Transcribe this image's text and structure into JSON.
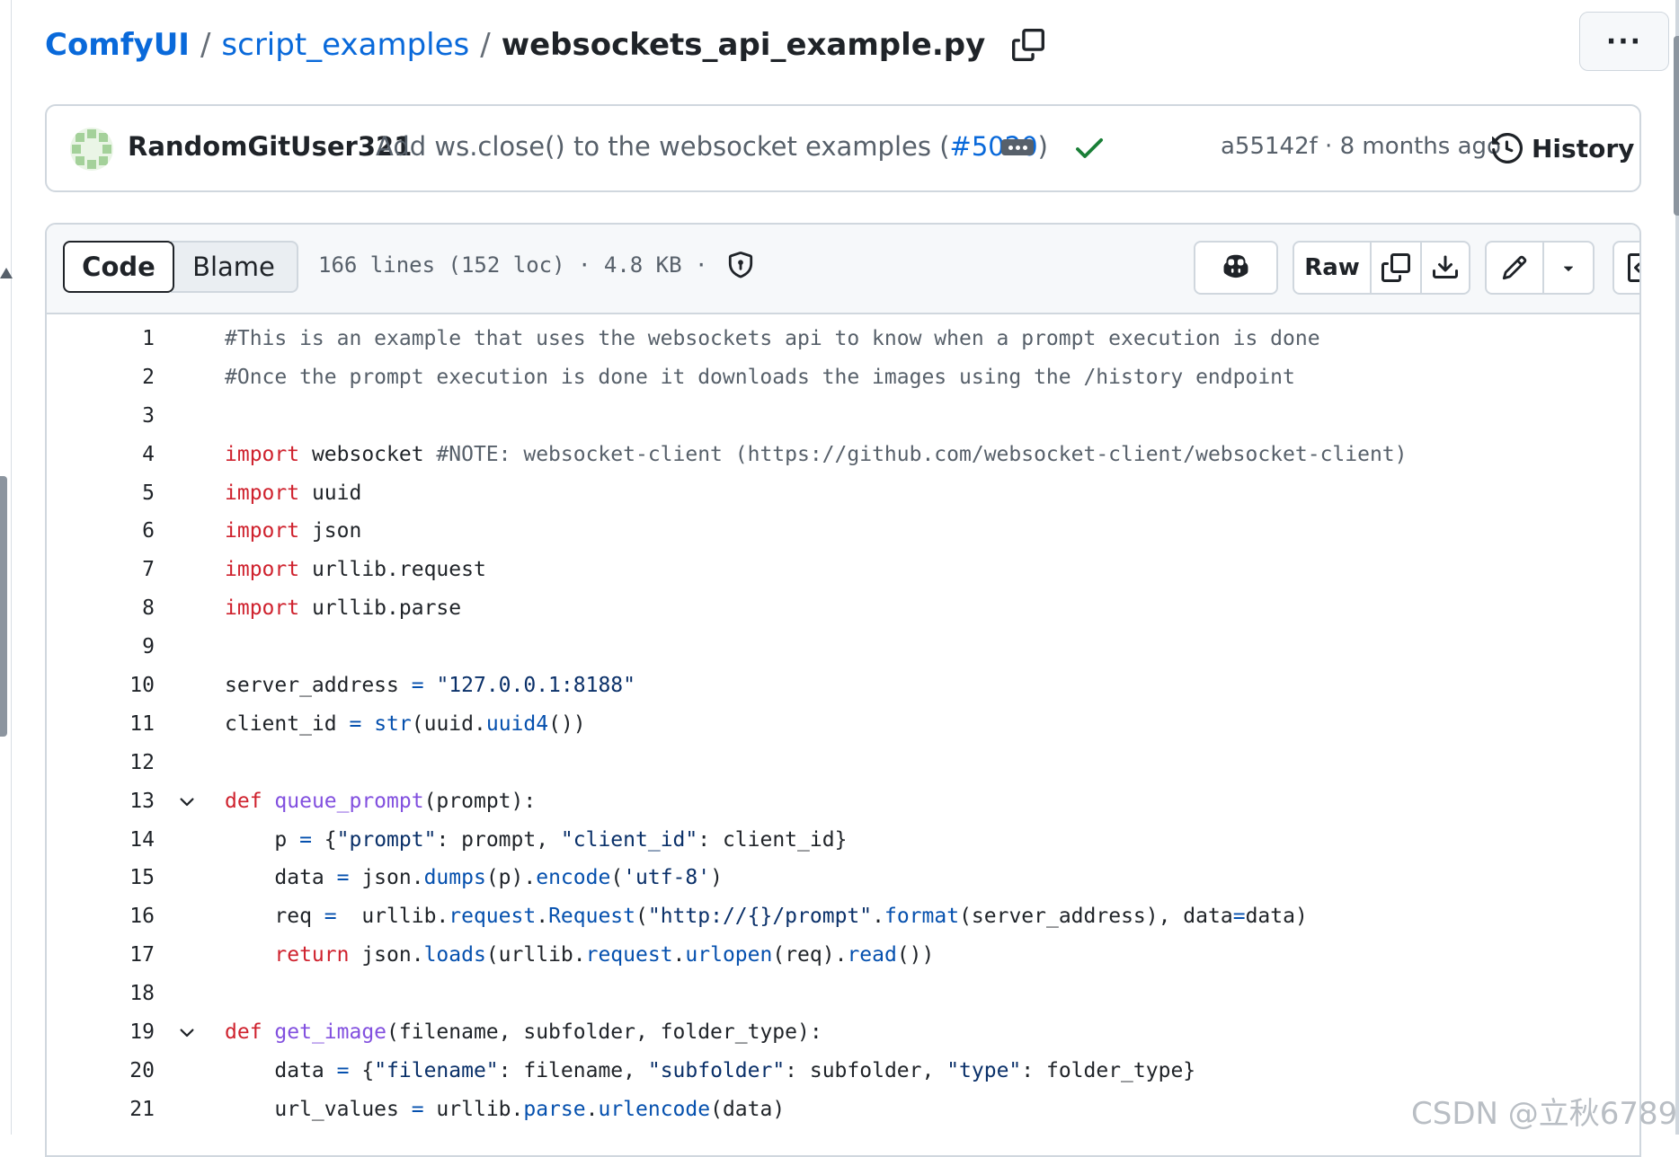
{
  "breadcrumb": {
    "repo": "ComfyUI",
    "separator": "/",
    "folder": "script_examples",
    "file": "websockets_api_example.py"
  },
  "commit": {
    "author": "RandomGitUser321",
    "message": "Add ws.close() to the websocket examples (",
    "pr": "#5020",
    "message_end": ")",
    "meta": "a55142f · 8 months ago",
    "history_label": "History"
  },
  "file_header": {
    "code_tab": "Code",
    "blame_tab": "Blame",
    "info": "166 lines (152 loc) · 4.8 KB ·",
    "raw_label": "Raw"
  },
  "icons": {
    "copy_path": "copy-icon",
    "more": "kebab-horizontal-icon",
    "check": "check-icon",
    "history": "history-icon",
    "shield": "shield-icon",
    "copilot": "copilot-icon",
    "copy_raw": "copy-icon",
    "download": "download-icon",
    "edit": "pencil-icon",
    "dropdown": "triangle-down-icon",
    "symbols": "code-square-icon",
    "fold": "chevron-down-icon"
  },
  "colors": {
    "link": "#0969da",
    "keyword": "#cf222e",
    "string": "#0a3069",
    "function": "#0550ae",
    "definition": "#8250df",
    "comment": "#57606a",
    "success": "#1a7f37"
  },
  "code_lines": [
    {
      "n": "1",
      "fold": false,
      "tokens": [
        [
          "comment",
          "#This is an example that uses the websockets api to know when a prompt execution is done"
        ]
      ]
    },
    {
      "n": "2",
      "fold": false,
      "tokens": [
        [
          "comment",
          "#Once the prompt execution is done it downloads the images using the /history endpoint"
        ]
      ]
    },
    {
      "n": "3",
      "fold": false,
      "tokens": []
    },
    {
      "n": "4",
      "fold": false,
      "tokens": [
        [
          "keyword",
          "import"
        ],
        [
          "plain",
          " websocket "
        ],
        [
          "comment",
          "#NOTE: websocket-client (https://github.com/websocket-client/websocket-client)"
        ]
      ]
    },
    {
      "n": "5",
      "fold": false,
      "tokens": [
        [
          "keyword",
          "import"
        ],
        [
          "plain",
          " uuid"
        ]
      ]
    },
    {
      "n": "6",
      "fold": false,
      "tokens": [
        [
          "keyword",
          "import"
        ],
        [
          "plain",
          " json"
        ]
      ]
    },
    {
      "n": "7",
      "fold": false,
      "tokens": [
        [
          "keyword",
          "import"
        ],
        [
          "plain",
          " urllib.request"
        ]
      ]
    },
    {
      "n": "8",
      "fold": false,
      "tokens": [
        [
          "keyword",
          "import"
        ],
        [
          "plain",
          " urllib.parse"
        ]
      ]
    },
    {
      "n": "9",
      "fold": false,
      "tokens": []
    },
    {
      "n": "10",
      "fold": false,
      "tokens": [
        [
          "plain",
          "server_address "
        ],
        [
          "op",
          "="
        ],
        [
          "plain",
          " "
        ],
        [
          "string",
          "\"127.0.0.1:8188\""
        ]
      ]
    },
    {
      "n": "11",
      "fold": false,
      "tokens": [
        [
          "plain",
          "client_id "
        ],
        [
          "op",
          "="
        ],
        [
          "plain",
          " "
        ],
        [
          "func",
          "str"
        ],
        [
          "plain",
          "(uuid."
        ],
        [
          "func",
          "uuid4"
        ],
        [
          "plain",
          "())"
        ]
      ]
    },
    {
      "n": "12",
      "fold": false,
      "tokens": []
    },
    {
      "n": "13",
      "fold": true,
      "tokens": [
        [
          "keyword",
          "def"
        ],
        [
          "plain",
          " "
        ],
        [
          "def",
          "queue_prompt"
        ],
        [
          "plain",
          "(prompt):"
        ]
      ]
    },
    {
      "n": "14",
      "fold": false,
      "tokens": [
        [
          "plain",
          "    p "
        ],
        [
          "op",
          "="
        ],
        [
          "plain",
          " {"
        ],
        [
          "string",
          "\"prompt\""
        ],
        [
          "plain",
          ": prompt, "
        ],
        [
          "string",
          "\"client_id\""
        ],
        [
          "plain",
          ": client_id}"
        ]
      ]
    },
    {
      "n": "15",
      "fold": false,
      "tokens": [
        [
          "plain",
          "    data "
        ],
        [
          "op",
          "="
        ],
        [
          "plain",
          " json."
        ],
        [
          "func",
          "dumps"
        ],
        [
          "plain",
          "(p)."
        ],
        [
          "func",
          "encode"
        ],
        [
          "plain",
          "("
        ],
        [
          "string",
          "'utf-8'"
        ],
        [
          "plain",
          ")"
        ]
      ]
    },
    {
      "n": "16",
      "fold": false,
      "tokens": [
        [
          "plain",
          "    req "
        ],
        [
          "op",
          "="
        ],
        [
          "plain",
          "  urllib."
        ],
        [
          "func",
          "request"
        ],
        [
          "plain",
          "."
        ],
        [
          "func",
          "Request"
        ],
        [
          "plain",
          "("
        ],
        [
          "string",
          "\"http://{}/prompt\""
        ],
        [
          "plain",
          "."
        ],
        [
          "func",
          "format"
        ],
        [
          "plain",
          "(server_address), data"
        ],
        [
          "op",
          "="
        ],
        [
          "plain",
          "data)"
        ]
      ]
    },
    {
      "n": "17",
      "fold": false,
      "tokens": [
        [
          "plain",
          "    "
        ],
        [
          "keyword",
          "return"
        ],
        [
          "plain",
          " json."
        ],
        [
          "func",
          "loads"
        ],
        [
          "plain",
          "(urllib."
        ],
        [
          "func",
          "request"
        ],
        [
          "plain",
          "."
        ],
        [
          "func",
          "urlopen"
        ],
        [
          "plain",
          "(req)."
        ],
        [
          "func",
          "read"
        ],
        [
          "plain",
          "())"
        ]
      ]
    },
    {
      "n": "18",
      "fold": false,
      "tokens": []
    },
    {
      "n": "19",
      "fold": true,
      "tokens": [
        [
          "keyword",
          "def"
        ],
        [
          "plain",
          " "
        ],
        [
          "def",
          "get_image"
        ],
        [
          "plain",
          "(filename, subfolder, folder_type):"
        ]
      ]
    },
    {
      "n": "20",
      "fold": false,
      "tokens": [
        [
          "plain",
          "    data "
        ],
        [
          "op",
          "="
        ],
        [
          "plain",
          " {"
        ],
        [
          "string",
          "\"filename\""
        ],
        [
          "plain",
          ": filename, "
        ],
        [
          "string",
          "\"subfolder\""
        ],
        [
          "plain",
          ": subfolder, "
        ],
        [
          "string",
          "\"type\""
        ],
        [
          "plain",
          ": folder_type}"
        ]
      ]
    },
    {
      "n": "21",
      "fold": false,
      "tokens": [
        [
          "plain",
          "    url_values "
        ],
        [
          "op",
          "="
        ],
        [
          "plain",
          " urllib."
        ],
        [
          "func",
          "parse"
        ],
        [
          "plain",
          "."
        ],
        [
          "func",
          "urlencode"
        ],
        [
          "plain",
          "(data)"
        ]
      ]
    }
  ],
  "watermark": "CSDN @立秋6789"
}
